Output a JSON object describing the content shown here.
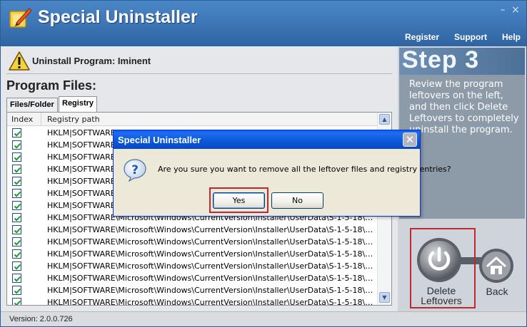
{
  "app": {
    "title": "Special Uninstaller",
    "minimize": "–",
    "close": "×"
  },
  "nav": {
    "register": "Register",
    "support": "Support",
    "help": "Help"
  },
  "program": {
    "label": "Uninstall Program: Iminent",
    "files_title": "Program Files:"
  },
  "tabs": [
    {
      "label": "Files/Folder",
      "active": false
    },
    {
      "label": "Registry",
      "active": true
    }
  ],
  "table": {
    "columns": [
      "Index",
      "Registry path"
    ],
    "rows": [
      {
        "checked": true,
        "path": "HKLM|SOFTWARE\\Microsoft\\Windows\\CurrentVersion\\Installer\\UserData\\S-1-5-18\\Compone..."
      },
      {
        "checked": true,
        "path": "HKLM|SOFTWARE\\Microsoft\\Windows\\CurrentVersion\\Installer\\UserData\\S-1-5-18\\Compone..."
      },
      {
        "checked": true,
        "path": "HKLM|SOFTWARE\\Microsoft\\Windows\\CurrentVersion\\Installer\\UserData\\S-1-5-18\\Compone..."
      },
      {
        "checked": true,
        "path": "HKLM|SOFTWARE\\Microsoft\\Windows\\CurrentVersion\\Installer\\UserData\\S-1-5-18\\Compone..."
      },
      {
        "checked": true,
        "path": "HKLM|SOFTWARE\\Microsoft\\Windows\\CurrentVersion\\Installer\\UserData\\S-1-5-18\\Compone..."
      },
      {
        "checked": true,
        "path": "HKLM|SOFTWARE\\Microsoft\\Windows\\CurrentVersion\\Installer\\UserData\\S-1-5-18\\Compone..."
      },
      {
        "checked": true,
        "path": "HKLM|SOFTWARE\\Microsoft\\Windows\\CurrentVersion\\Installer\\UserData\\S-1-5-18\\Compone..."
      },
      {
        "checked": true,
        "path": "HKLM|SOFTWARE\\Microsoft\\Windows\\CurrentVersion\\Installer\\UserData\\S-1-5-18\\Compone..."
      },
      {
        "checked": true,
        "path": "HKLM|SOFTWARE\\Microsoft\\Windows\\CurrentVersion\\Installer\\UserData\\S-1-5-18\\Compone..."
      },
      {
        "checked": true,
        "path": "HKLM|SOFTWARE\\Microsoft\\Windows\\CurrentVersion\\Installer\\UserData\\S-1-5-18\\Compone..."
      },
      {
        "checked": true,
        "path": "HKLM|SOFTWARE\\Microsoft\\Windows\\CurrentVersion\\Installer\\UserData\\S-1-5-18\\Compone..."
      },
      {
        "checked": true,
        "path": "HKLM|SOFTWARE\\Microsoft\\Windows\\CurrentVersion\\Installer\\UserData\\S-1-5-18\\Compone..."
      },
      {
        "checked": true,
        "path": "HKLM|SOFTWARE\\Microsoft\\Windows\\CurrentVersion\\Installer\\UserData\\S-1-5-18\\Compone..."
      },
      {
        "checked": true,
        "path": "HKLM|SOFTWARE\\Microsoft\\Windows\\CurrentVersion\\Installer\\UserData\\S-1-5-18\\Compone..."
      },
      {
        "checked": true,
        "path": "HKLM|SOFTWARE\\Microsoft\\Windows\\CurrentVersion\\Installer\\UserData\\S-1-5-18\\Compone..."
      }
    ]
  },
  "step": {
    "title": "Step 3",
    "description": "Review the program leftovers on the left, and then click Delete Leftovers to completely uninstall the program."
  },
  "actions": {
    "delete_label": "Delete Leftovers",
    "back_label": "Back"
  },
  "status": {
    "version": "Version: 2.0.0.726"
  },
  "dialog": {
    "title": "Special Uninstaller",
    "message": "Are you sure you want to remove all the leftover files and registry entries?",
    "yes": "Yes",
    "no": "No"
  },
  "colors": {
    "titlebar": "#3f78b8",
    "dialog_titlebar": "#0a58d8",
    "highlight": "#c1272d",
    "check": "#1a9a2a"
  },
  "icons": {
    "app": "pencil-box-icon",
    "warning": "warning-icon",
    "question": "question-icon",
    "power": "power-icon",
    "home": "home-icon",
    "checkbox": "checkbox-checked-icon"
  }
}
